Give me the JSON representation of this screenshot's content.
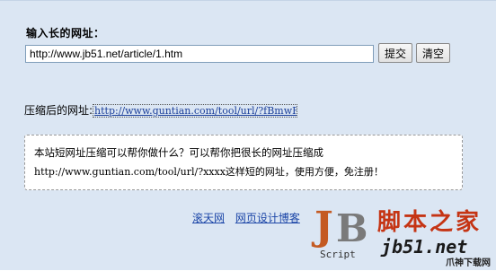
{
  "form": {
    "title": "输入长的网址：",
    "url_value": "http://www.jb51.net/article/1.htm",
    "submit_label": "提交",
    "clear_label": "清空"
  },
  "result": {
    "label": "压缩后的网址:",
    "link_text": "http://www.guntian.com/tool/url/?fBmwRe"
  },
  "notice": {
    "line1": "本站短网址压缩可以帮你做什么？可以帮你把很长的网址压缩成",
    "line2": "http://www.guntian.com/tool/url/?xxxx这样短的网址，使用方便，免注册！"
  },
  "footer_links": [
    "滚天网",
    "网页设计博客"
  ],
  "watermark": {
    "brand_cn": "脚本之家",
    "script": "Script",
    "domain": "jb51.net",
    "corner": "爪神下载网"
  }
}
